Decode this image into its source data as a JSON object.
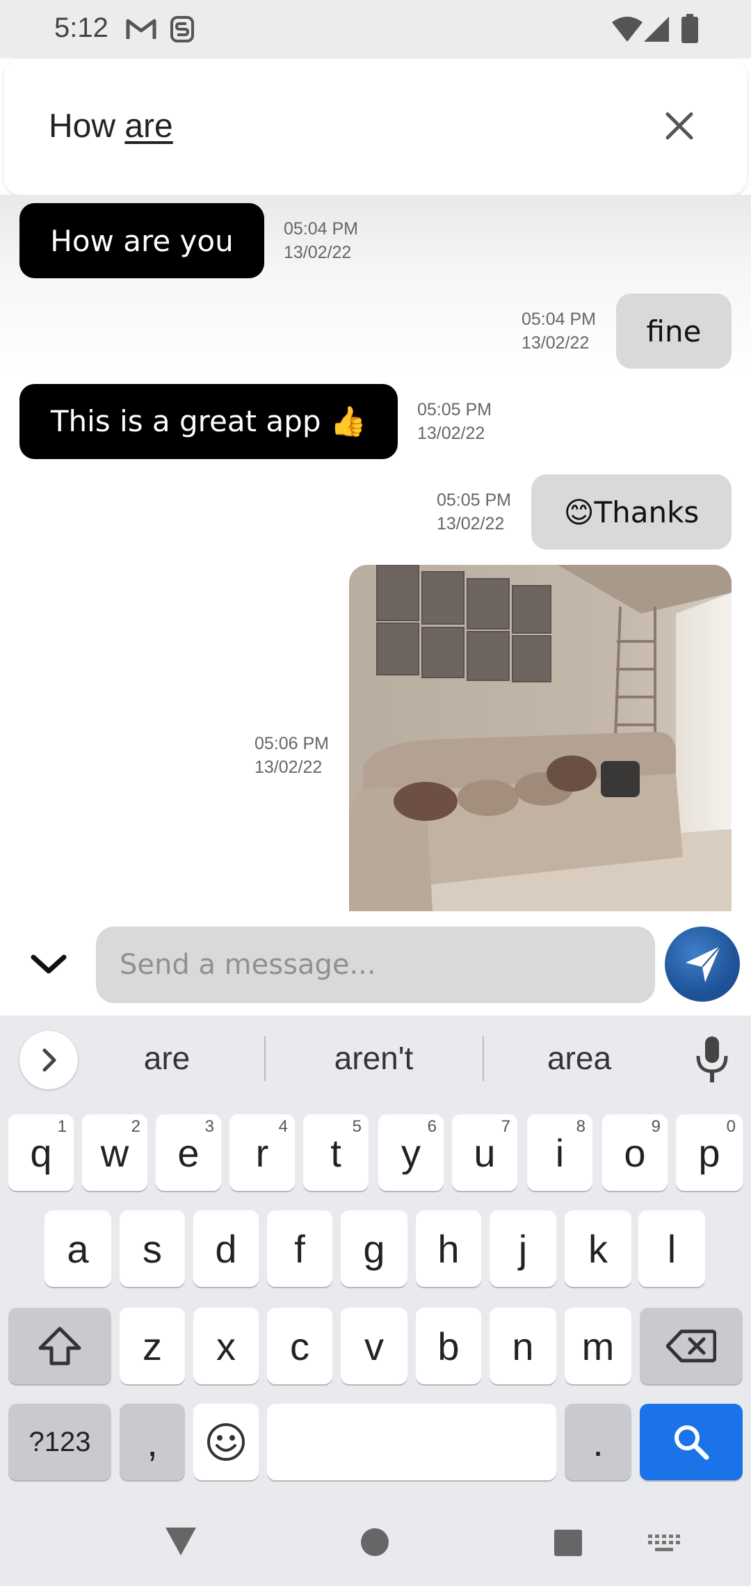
{
  "status_bar": {
    "time": "5:12",
    "left_icons": [
      "gmail-icon",
      "notification-s-icon"
    ],
    "right_icons": [
      "wifi-icon",
      "cellular-signal-icon",
      "battery-icon"
    ]
  },
  "search": {
    "query_prefix": "How ",
    "query_underlined": "are",
    "close_icon": "close-icon"
  },
  "messages": [
    {
      "direction": "in",
      "text": "How are you",
      "time": "05:04 PM",
      "date": "13/02/22"
    },
    {
      "direction": "out",
      "text": "fine",
      "time": "05:04 PM",
      "date": "13/02/22"
    },
    {
      "direction": "in",
      "text": "This is a great app 👍",
      "time": "05:05 PM",
      "date": "13/02/22"
    },
    {
      "direction": "out",
      "text": "😊Thanks",
      "time": "05:05 PM",
      "date": "13/02/22"
    },
    {
      "direction": "out",
      "type": "image",
      "image_subject": "living room sofa photo",
      "time": "05:06 PM",
      "date": "13/02/22"
    }
  ],
  "composer": {
    "placeholder": "Send a message...",
    "collapse_icon": "chevron-down-icon",
    "send_icon": "send-icon"
  },
  "keyboard": {
    "suggestions": [
      "are",
      "aren't",
      "area"
    ],
    "row1": [
      {
        "key": "q",
        "hint": "1"
      },
      {
        "key": "w",
        "hint": "2"
      },
      {
        "key": "e",
        "hint": "3"
      },
      {
        "key": "r",
        "hint": "4"
      },
      {
        "key": "t",
        "hint": "5"
      },
      {
        "key": "y",
        "hint": "6"
      },
      {
        "key": "u",
        "hint": "7"
      },
      {
        "key": "i",
        "hint": "8"
      },
      {
        "key": "o",
        "hint": "9"
      },
      {
        "key": "p",
        "hint": "0"
      }
    ],
    "row2": [
      "a",
      "s",
      "d",
      "f",
      "g",
      "h",
      "j",
      "k",
      "l"
    ],
    "row3": [
      "z",
      "x",
      "c",
      "v",
      "b",
      "n",
      "m"
    ],
    "symbols_label": "?123",
    "comma_label": ",",
    "period_label": ".",
    "accent_color": "#1a73e8"
  },
  "nav_bar": {
    "icons": [
      "back-icon",
      "home-icon",
      "recents-icon",
      "keyboard-switch-icon"
    ]
  }
}
